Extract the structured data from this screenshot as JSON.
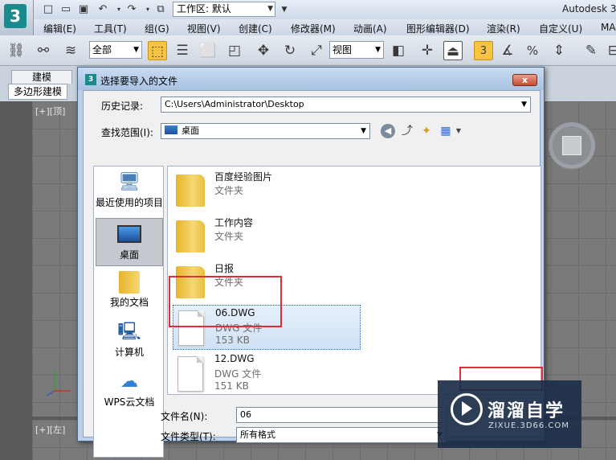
{
  "app": {
    "workspace_value": "工作区: 默认",
    "title_text": "Autodesk 3"
  },
  "menu": [
    "编辑(E)",
    "工具(T)",
    "组(G)",
    "视图(V)",
    "创建(C)",
    "修改器(M)",
    "动画(A)",
    "图形编辑器(D)",
    "渲染(R)",
    "自定义(U)",
    "MA"
  ],
  "toolbar": {
    "selection_filter": "全部",
    "ref_coord": "视图",
    "snap_number": "3",
    "percent": "%"
  },
  "ribbon": {
    "tab_label": "建模",
    "panel_label": "多边形建模"
  },
  "viewports": {
    "top_left_label": "[+][顶]",
    "bottom_left_label": "[+][左]"
  },
  "dialog": {
    "title": "选择要导入的文件",
    "close_glyph": "x",
    "history_label": "历史记录:",
    "history_value": "C:\\Users\\Administrator\\Desktop",
    "lookin_label": "查找范围(I):",
    "lookin_value": "桌面",
    "filename_label": "文件名(N):",
    "filename_value": "06",
    "filetype_label": "文件类型(T):",
    "filetype_value": "所有格式"
  },
  "places": [
    {
      "label": "最近使用的项目",
      "icon": "recent-icon"
    },
    {
      "label": "桌面",
      "icon": "desktop-icon",
      "selected": true
    },
    {
      "label": "我的文档",
      "icon": "documents-icon"
    },
    {
      "label": "计算机",
      "icon": "computer-icon"
    },
    {
      "label": "WPS云文档",
      "icon": "cloud-icon"
    }
  ],
  "files": [
    {
      "name": "百度经验图片",
      "type": "文件夹",
      "size": "",
      "kind": "folder"
    },
    {
      "name": "工作内容",
      "type": "文件夹",
      "size": "",
      "kind": "folder"
    },
    {
      "name": "日报",
      "type": "文件夹",
      "size": "",
      "kind": "folder"
    },
    {
      "name": "06.DWG",
      "type": "DWG 文件",
      "size": "153 KB",
      "kind": "file",
      "selected": true
    },
    {
      "name": "12.DWG",
      "type": "DWG 文件",
      "size": "151 KB",
      "kind": "file"
    }
  ],
  "watermark": {
    "name": "溜溜自学",
    "url": "ZIXUE.3D66.COM"
  },
  "colors": {
    "highlight_box": "#d9303a",
    "selection": "#cfe1f6",
    "watermark_bg": "#1c2e48"
  }
}
